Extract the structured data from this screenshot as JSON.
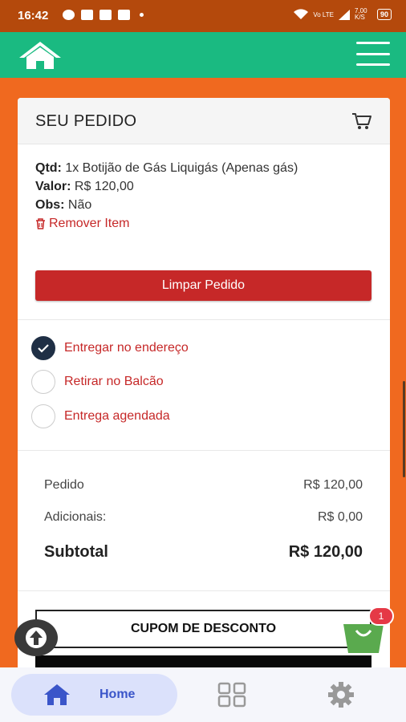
{
  "status_bar": {
    "time": "16:42",
    "network_label": "Vo LTE",
    "speed": "7,00 K/S",
    "battery": "90"
  },
  "order": {
    "title": "SEU PEDIDO",
    "qtd_label": "Qtd:",
    "qtd_value": "1x Botijão de Gás Liquigás (Apenas gás)",
    "valor_label": "Valor:",
    "valor_value": "R$ 120,00",
    "obs_label": "Obs:",
    "obs_value": "Não",
    "remove_label": "Remover Item",
    "clear_button": "Limpar Pedido"
  },
  "delivery_options": [
    {
      "label": "Entregar no endereço",
      "selected": true
    },
    {
      "label": "Retirar no Balcão",
      "selected": false
    },
    {
      "label": "Entrega agendada",
      "selected": false
    }
  ],
  "summary": {
    "pedido_label": "Pedido",
    "pedido_value": "R$ 120,00",
    "adicionais_label": "Adicionais:",
    "adicionais_value": "R$ 0,00",
    "subtotal_label": "Subtotal",
    "subtotal_value": "R$ 120,00"
  },
  "coupon_button": "CUPOM DE DESCONTO",
  "bag_badge": "1",
  "bottom_nav": {
    "home_label": "Home"
  },
  "colors": {
    "app_bar": "#1aba81",
    "background": "#f0691f",
    "accent_red": "#c62828",
    "nav_highlight": "#dbe1fb"
  },
  "icons": [
    "home-logo-icon",
    "menu-icon",
    "cart-icon",
    "trash-icon",
    "check-icon",
    "arrow-up-icon",
    "shopping-bag-icon",
    "home-icon",
    "grid-icon",
    "gear-icon"
  ]
}
